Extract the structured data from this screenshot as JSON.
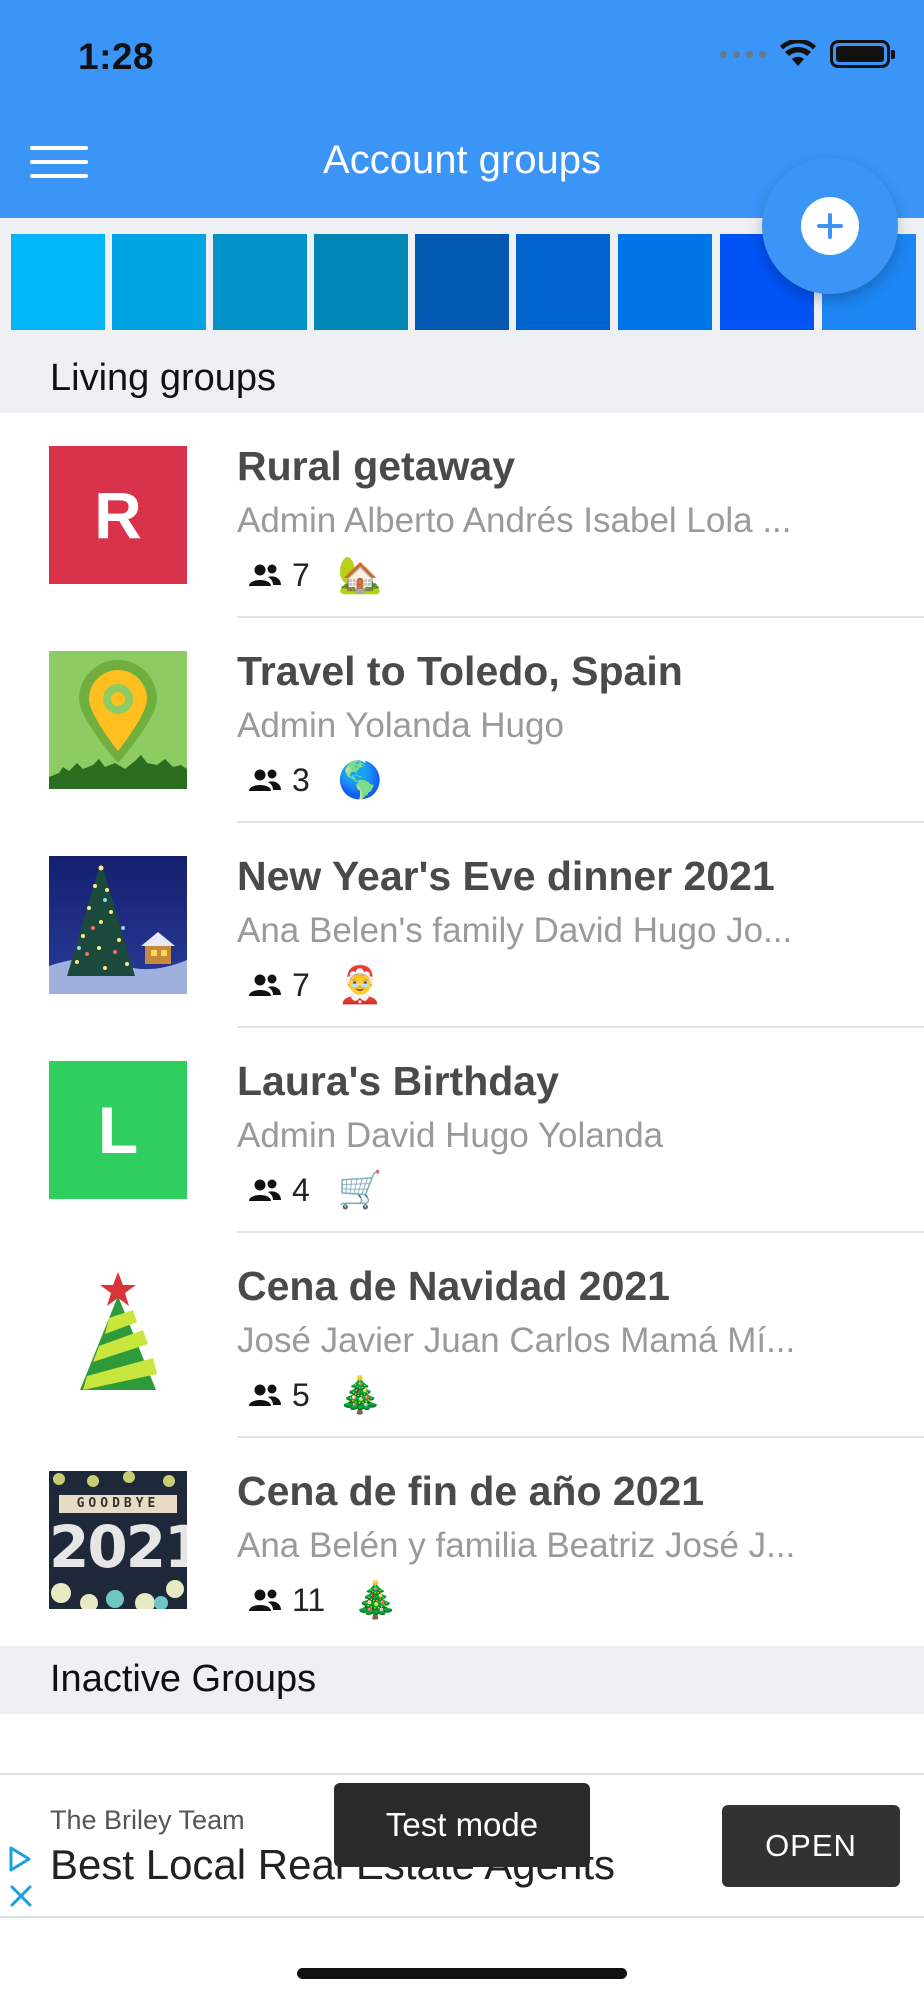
{
  "status_bar": {
    "time": "1:28"
  },
  "header": {
    "title": "Account groups"
  },
  "color_strip": {
    "swatches": [
      "#00b6f6",
      "#00a4e4",
      "#0092c8",
      "#0187b5",
      "#0058b0",
      "#0064ce",
      "#0075e8",
      "#0153f5",
      "#1d86f4"
    ]
  },
  "sections": {
    "living": "Living groups",
    "inactive": "Inactive Groups"
  },
  "groups": [
    {
      "name": "Rural getaway",
      "members": "Admin Alberto Andrés Isabel Lola ...",
      "count": "7",
      "emoji": "🏡",
      "thumb_letter": "R",
      "thumb_color": "#d8334a"
    },
    {
      "name": "Travel to Toledo, Spain",
      "members": "Admin Yolanda Hugo",
      "count": "3",
      "emoji": "🌎"
    },
    {
      "name": "New Year's Eve dinner 2021",
      "members": "Ana Belen's family David Hugo Jo...",
      "count": "7",
      "emoji": "🤶"
    },
    {
      "name": "Laura's Birthday",
      "members": "Admin David Hugo Yolanda",
      "count": "4",
      "emoji": "🛒",
      "thumb_letter": "L",
      "thumb_color": "#2ecf5e"
    },
    {
      "name": "Cena de Navidad 2021",
      "members": "José Javier Juan Carlos Mamá Mí...",
      "count": "5",
      "emoji": "🎄"
    },
    {
      "name": "Cena de fin de año 2021",
      "members": "Ana Belén y familia Beatriz José J...",
      "count": "11",
      "emoji": "🎄",
      "thumb_text_top": "GOODBYE",
      "thumb_text_main": "2021"
    }
  ],
  "ad": {
    "advertiser": "The Briley Team",
    "headline": "Best Local Real Estate Agents",
    "cta": "OPEN",
    "toast": "Test mode"
  }
}
